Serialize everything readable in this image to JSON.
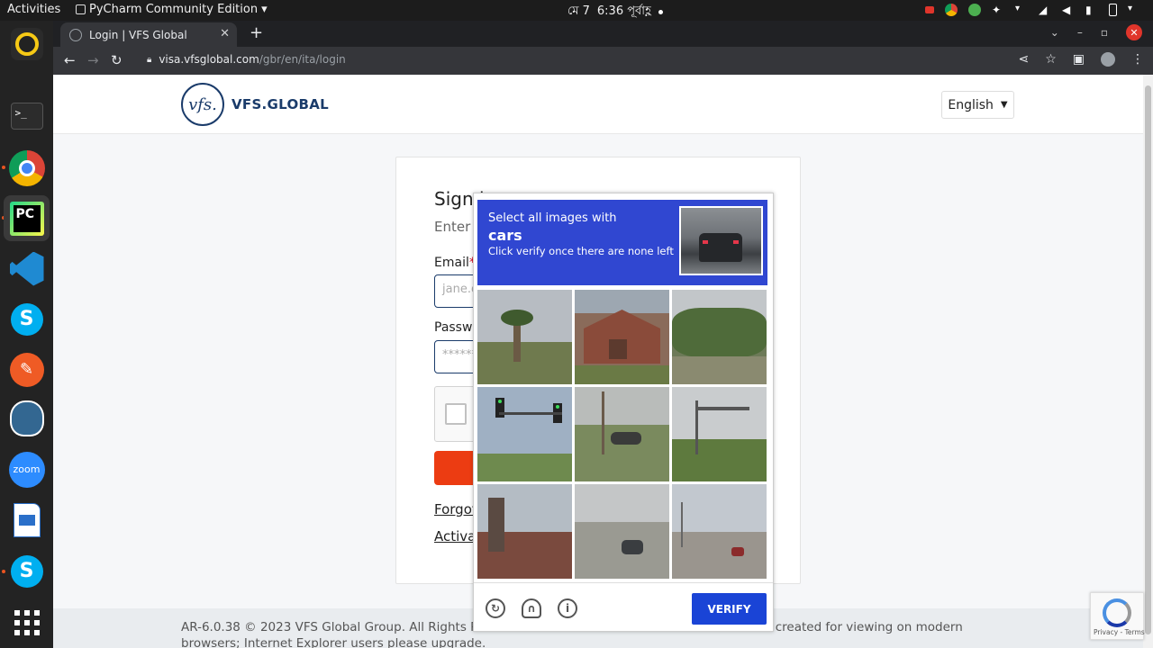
{
  "topbar": {
    "activities": "Activities",
    "app_name": "PyCharm Community Edition",
    "date": "মে 7",
    "time": "6:36 পূর্বাহ্ণ"
  },
  "dock": {
    "items": [
      "rhythmbox-icon",
      "terminal-icon",
      "chrome-icon",
      "pycharm-icon",
      "vscode-icon",
      "skype-icon",
      "postman-icon",
      "postgres-icon",
      "zoom-icon",
      "libreoffice-writer-icon",
      "skype-icon",
      "show-apps-icon"
    ],
    "zoom_label": "zoom"
  },
  "browser": {
    "tab_title": "Login | VFS Global",
    "url_host": "visa.vfsglobal.com",
    "url_path": "/gbr/en/ita/login"
  },
  "page": {
    "logo_text": "VFS.GLOBAL",
    "logo_mark": "vfs.",
    "language": "English",
    "sign_in_title": "Sign in",
    "sign_in_sub": "Enter",
    "email_label": "Email",
    "email_placeholder": "jane.d",
    "password_label": "Passwo",
    "password_placeholder": "******",
    "forgot_link": "Forgot",
    "activate_link": "Activa",
    "footer_text": "AR-6.0.38 © 2023 VFS Global Group. All Rights Rese",
    "footer_text_right": "are created for viewing on modern",
    "footer_text_line2": "browsers; Internet Explorer users please upgrade."
  },
  "challenge": {
    "line1": "Select all images with",
    "line2": "cars",
    "line3": "Click verify once there are none left",
    "verify_label": "VERIFY",
    "colors": {
      "header": "#3047d1",
      "verify": "#1a44d6"
    }
  },
  "recaptcha_badge": {
    "text": "Privacy - Terms"
  }
}
